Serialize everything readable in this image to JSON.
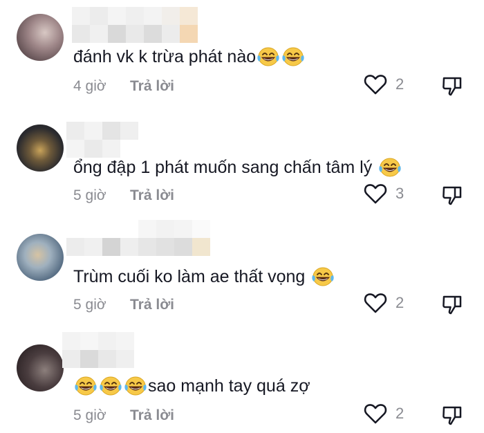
{
  "comments": [
    {
      "text": "đánh vk k trừa phát nào",
      "emoji_before": 0,
      "emoji_after": 2,
      "time": "4 giờ",
      "reply_label": "Trả lời",
      "likes": "2",
      "avatar_colors": [
        "#6d5a5c",
        "#c9b7b4"
      ]
    },
    {
      "text": "ổng đập 1 phát muốn sang chấn tâm lý",
      "emoji_before": 0,
      "emoji_after": 1,
      "time": "5 giờ",
      "reply_label": "Trả lời",
      "likes": "3",
      "avatar_colors": [
        "#2b2a2e",
        "#c7a65a"
      ]
    },
    {
      "text": "Trùm cuối ko làm ae thất vọng",
      "emoji_before": 0,
      "emoji_after": 1,
      "time": "5 giờ",
      "reply_label": "Trả lời",
      "likes": "2",
      "avatar_colors": [
        "#8fa3b5",
        "#c8b89d"
      ]
    },
    {
      "text": "sao mạnh tay quá zợ",
      "emoji_before": 3,
      "emoji_after": 0,
      "time": "5 giờ",
      "reply_label": "Trả lời",
      "likes": "2",
      "avatar_colors": [
        "#2e2426",
        "#7a6d6b"
      ]
    }
  ],
  "icons": {
    "like": "heart-outline-icon",
    "dislike": "thumbs-down-outline-icon",
    "emoji": "face-with-tears-of-joy-emoji"
  },
  "colors": {
    "text": "#161823",
    "secondary": "#8a8b91",
    "emoji": "#f7c948"
  }
}
